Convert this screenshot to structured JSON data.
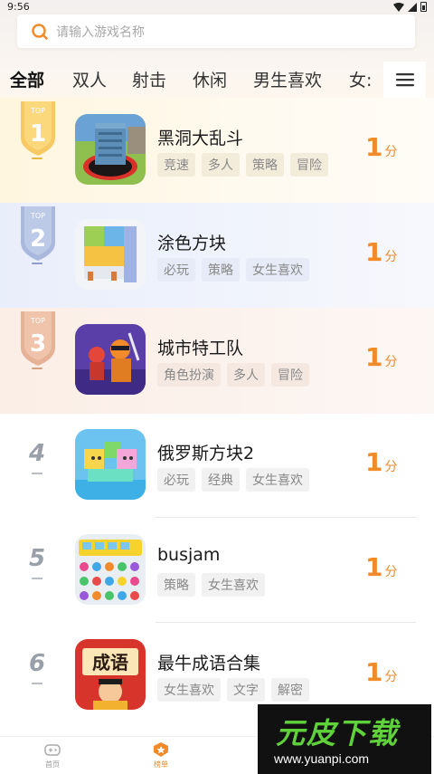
{
  "status": {
    "time": "9:56"
  },
  "search": {
    "placeholder": "请输入游戏名称"
  },
  "tabs": [
    {
      "label": "全部"
    },
    {
      "label": "双人"
    },
    {
      "label": "射击"
    },
    {
      "label": "休闲"
    },
    {
      "label": "男生喜欢"
    },
    {
      "label": "女:"
    }
  ],
  "ranking": {
    "items": [
      {
        "rank": "1",
        "medal_text": "TOP",
        "title": "黑洞大乱斗",
        "tags": [
          "竞速",
          "多人",
          "策略",
          "冒险"
        ],
        "score": "1",
        "score_unit": "分"
      },
      {
        "rank": "2",
        "medal_text": "TOP",
        "title": "涂色方块",
        "tags": [
          "必玩",
          "策略",
          "女生喜欢"
        ],
        "score": "1",
        "score_unit": "分"
      },
      {
        "rank": "3",
        "medal_text": "TOP",
        "title": "城市特工队",
        "tags": [
          "角色扮演",
          "多人",
          "冒险"
        ],
        "score": "1",
        "score_unit": "分"
      },
      {
        "rank": "4",
        "title": "俄罗斯方块2",
        "tags": [
          "必玩",
          "经典",
          "女生喜欢"
        ],
        "score": "1",
        "score_unit": "分"
      },
      {
        "rank": "5",
        "title": "busjam",
        "tags": [
          "策略",
          "女生喜欢"
        ],
        "score": "1",
        "score_unit": "分"
      },
      {
        "rank": "6",
        "title": "最牛成语合集",
        "tags": [
          "女生喜欢",
          "文字",
          "解密"
        ],
        "score": "1",
        "score_unit": "分"
      }
    ]
  },
  "bottom_nav": {
    "home_label": "首页",
    "rank_label": "榜单"
  },
  "icon_text": {
    "idiom_icon_text": "成语"
  },
  "watermark": {
    "main": "元皮下载",
    "url": "www.yuanpi.com"
  },
  "colors": {
    "accent": "#f08a2a",
    "gold": "#f3c75a",
    "silver": "#a9b8dc",
    "bronze": "#e8b79a"
  }
}
